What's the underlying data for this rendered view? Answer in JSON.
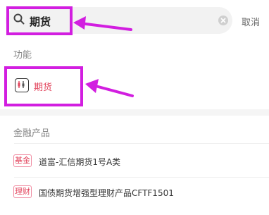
{
  "search": {
    "value": "期货",
    "cancel_label": "取消"
  },
  "sections": {
    "function_header": "功能",
    "products_header": "金融产品"
  },
  "function_item": {
    "label": "期货",
    "icon": "futures-chart-icon"
  },
  "products": [
    {
      "badge": "基金",
      "name": "道富-汇信期货1号A类"
    },
    {
      "badge": "理财",
      "name": "国债期货增强型理财产品CFTF1501"
    }
  ],
  "colors": {
    "accent_red": "#e2445c",
    "annotation_magenta": "#d21ee0"
  }
}
